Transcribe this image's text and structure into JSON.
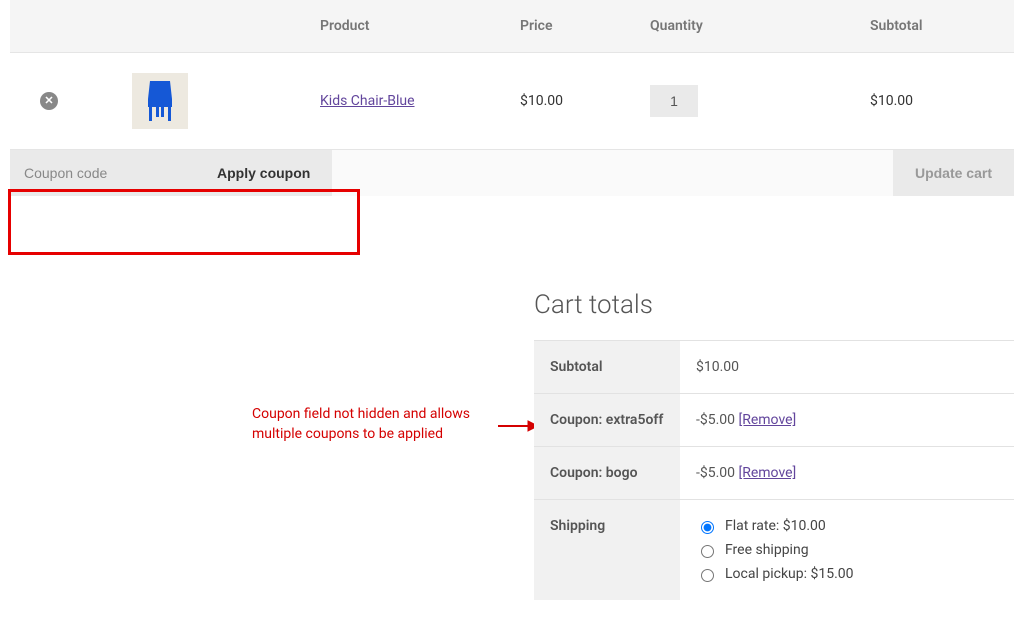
{
  "table": {
    "headers": {
      "product": "Product",
      "price": "Price",
      "qty": "Quantity",
      "subtotal": "Subtotal"
    },
    "item": {
      "name": "Kids Chair-Blue",
      "price": "$10.00",
      "qty": "1",
      "subtotal": "$10.00"
    }
  },
  "coupon": {
    "placeholder": "Coupon code",
    "apply_label": "Apply coupon",
    "update_label": "Update cart"
  },
  "annotation": {
    "line1": "Coupon field not hidden and allows",
    "line2": "multiple coupons to be applied"
  },
  "totals": {
    "title": "Cart totals",
    "subtotal_label": "Subtotal",
    "subtotal_value": "$10.00",
    "coupon1_label": "Coupon: extra5off",
    "coupon1_value": "-$5.00 ",
    "coupon2_label": "Coupon: bogo",
    "coupon2_value": "-$5.00 ",
    "remove_text": "[Remove]",
    "shipping_label": "Shipping",
    "shipping_opts": {
      "flat": "Flat rate: $10.00",
      "free": "Free shipping",
      "local": "Local pickup: $15.00"
    }
  }
}
